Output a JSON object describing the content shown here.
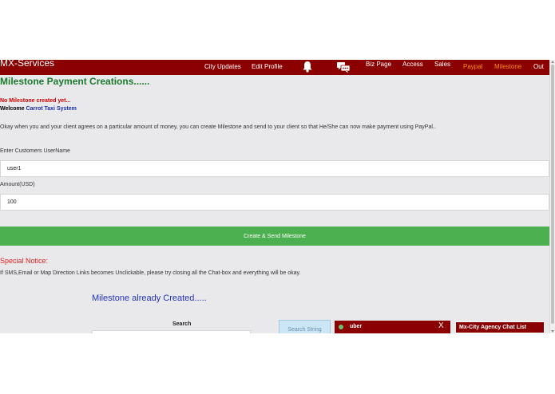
{
  "nav": {
    "brand": "MX-Services",
    "links": {
      "city_updates": "City Updates",
      "edit_profile": "Edit Profile",
      "biz_page": "Biz Page",
      "access": "Access",
      "sales": "Sales",
      "paypal": "Paypal",
      "milestone": "Milestone",
      "out": "Out"
    },
    "icons": {
      "notifications": "bell-icon",
      "messages": "chat-icon"
    },
    "colors": {
      "bar": "#8b0000",
      "active_link": "#ff8c00"
    }
  },
  "page": {
    "title": "Milestone Payment Creations......",
    "no_milestone": "No Milestone created yet...",
    "welcome_prefix": "Welcome",
    "company": "Carrot Taxi System",
    "description": "Okay when you and your client agrees on a particular amount of money, you can create Milestone and send to your client so that He/She can now make payment using PayPal.."
  },
  "form": {
    "username_label": "Enter Customers UserName",
    "username_value": "user1",
    "amount_label": "Amount(USD)",
    "amount_value": "100",
    "submit_label": "Create & Send Milestone",
    "submit_color": "#4caf50"
  },
  "notice": {
    "title": "Special Notice:",
    "text": "If SMS,Email or Map Direction Links becomes Unclickable, please try closing all the Chat-box and everything will be okay."
  },
  "existing": {
    "title": "Milestone already Created.....",
    "search_label": "Search",
    "search_value": "",
    "search_button": "Search String"
  },
  "chat": {
    "box_name": "uber",
    "close_glyph": "X",
    "agency_list_title": "Mx-City Agency Chat List"
  }
}
